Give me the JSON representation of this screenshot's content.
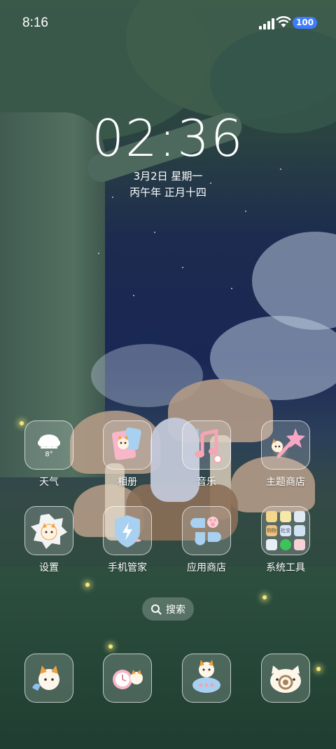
{
  "status_bar": {
    "time": "8:16",
    "battery": "100"
  },
  "clock": {
    "time": "02:36",
    "date": "3月2日 星期一",
    "lunar": "丙午年 正月十四"
  },
  "weather_widget": {
    "temperature": "8°"
  },
  "apps_row1": [
    {
      "label": "天气"
    },
    {
      "label": "相册"
    },
    {
      "label": "音乐"
    },
    {
      "label": "主题商店"
    }
  ],
  "apps_row2": [
    {
      "label": "设置"
    },
    {
      "label": "手机管家"
    },
    {
      "label": "应用商店"
    },
    {
      "label": "系统工具"
    }
  ],
  "folder_mini_labels": [
    "购物",
    "社交"
  ],
  "search": {
    "label": "搜索"
  },
  "dock": [
    {
      "icon": "cat-phone-icon"
    },
    {
      "icon": "cat-clock-icon"
    },
    {
      "icon": "cat-message-icon"
    },
    {
      "icon": "cat-camera-icon"
    }
  ],
  "colors": {
    "battery_badge": "#3d7cff",
    "sky": "#1a2755",
    "foliage": "#3b5a4a"
  }
}
